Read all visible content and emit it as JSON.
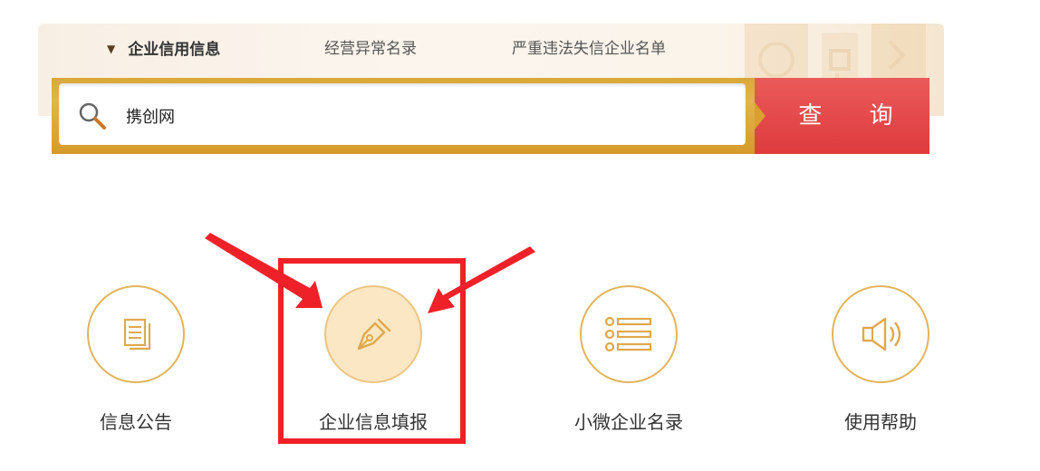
{
  "nav": {
    "tabs": [
      {
        "label": "企业信用信息",
        "active": true
      },
      {
        "label": "经营异常名录",
        "active": false
      },
      {
        "label": "严重违法失信企业名单",
        "active": false
      }
    ]
  },
  "search": {
    "value": "携创网",
    "button_label": "查 询"
  },
  "quick_items": [
    {
      "label": "信息公告",
      "icon": "document-icon"
    },
    {
      "label": "企业信息填报",
      "icon": "pen-nib-icon",
      "highlighted": true
    },
    {
      "label": "小微企业名录",
      "icon": "list-icon"
    },
    {
      "label": "使用帮助",
      "icon": "speaker-icon"
    }
  ],
  "colors": {
    "gold": "#e1b45a",
    "search_border": "#d9a83a",
    "button_red": "#e04547",
    "highlight_red": "#ee2129"
  }
}
